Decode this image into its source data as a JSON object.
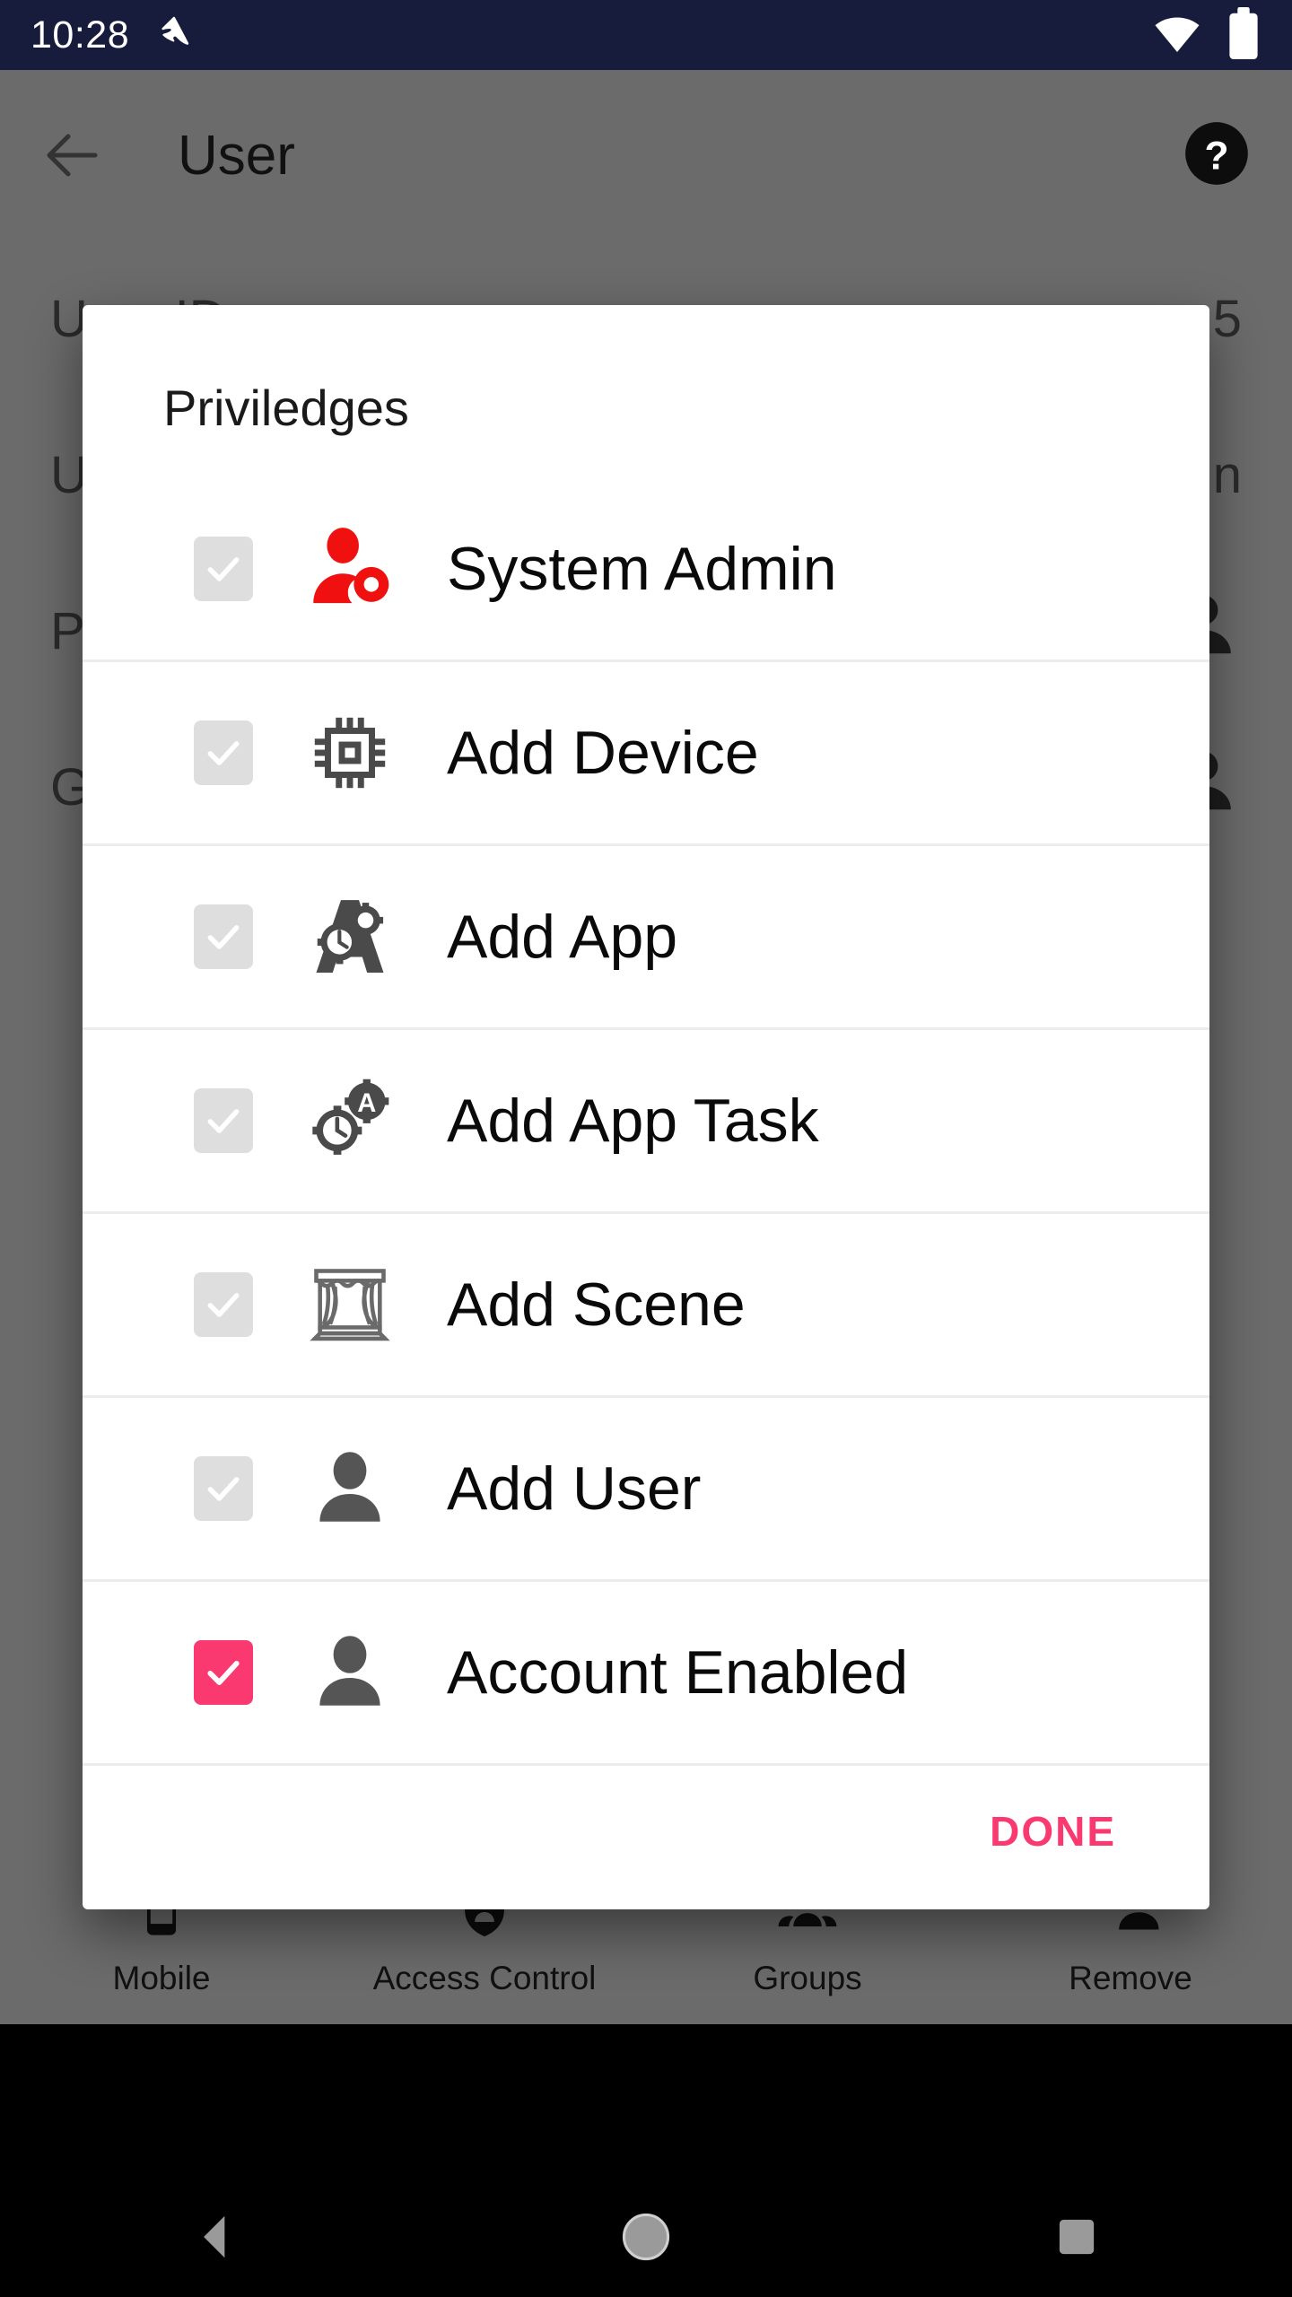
{
  "status_bar": {
    "time": "10:28",
    "left_icons": [
      "notification-icon"
    ],
    "right_icons": [
      "wifi-icon",
      "battery-icon"
    ],
    "background_color": "#171c3c"
  },
  "app_bar": {
    "back_icon": "back-arrow-icon",
    "title": "User",
    "help_icon": "help-circle-icon"
  },
  "background_screen": {
    "rows": [
      {
        "label": "User ID",
        "value": "5",
        "value_type": "text"
      },
      {
        "label": "User Name",
        "value": "un",
        "value_type": "text"
      },
      {
        "label": "Priviledges",
        "value": "",
        "value_type": "person-icon"
      },
      {
        "label": "Groups",
        "value": "",
        "value_type": "person-icon"
      }
    ]
  },
  "dialog": {
    "title": "Priviledges",
    "items": [
      {
        "label": "System Admin",
        "icon": "user-settings-icon",
        "checked": false,
        "enabled": false
      },
      {
        "label": "Add Device",
        "icon": "chip-icon",
        "checked": false,
        "enabled": false
      },
      {
        "label": "Add App",
        "icon": "app-gears-icon",
        "checked": false,
        "enabled": false
      },
      {
        "label": "Add App Task",
        "icon": "task-gears-icon",
        "checked": false,
        "enabled": false
      },
      {
        "label": "Add Scene",
        "icon": "stage-curtain-icon",
        "checked": false,
        "enabled": false
      },
      {
        "label": "Add User",
        "icon": "person-icon",
        "checked": false,
        "enabled": false
      },
      {
        "label": "Account Enabled",
        "icon": "person-icon",
        "checked": true,
        "enabled": true
      }
    ],
    "done_label": "DONE",
    "accent_color": "#f9396f"
  },
  "tab_bar": {
    "tabs": [
      {
        "label": "Mobile",
        "icon": "phone-icon"
      },
      {
        "label": "Access Control",
        "icon": "shield-person-icon"
      },
      {
        "label": "Groups",
        "icon": "people-icon"
      },
      {
        "label": "Remove",
        "icon": "person-remove-icon"
      }
    ]
  },
  "nav_bar": {
    "buttons": [
      {
        "name": "back",
        "icon": "nav-back-triangle-icon"
      },
      {
        "name": "home",
        "icon": "nav-home-circle-icon"
      },
      {
        "name": "recents",
        "icon": "nav-recents-square-icon"
      }
    ]
  }
}
